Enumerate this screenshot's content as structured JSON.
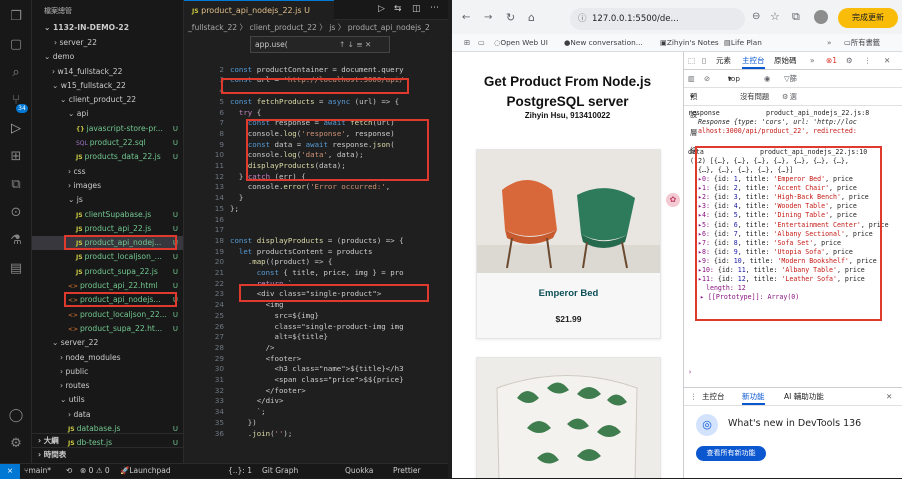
{
  "explorer": {
    "header": "檔案總管",
    "root": "1132-IN-DEMO-22",
    "items": [
      {
        "label": "server_22",
        "kind": "folder",
        "open": false,
        "git": ""
      },
      {
        "label": "demo",
        "kind": "folder",
        "open": true,
        "git": ""
      },
      {
        "label": "w14_fullstack_22",
        "kind": "folder",
        "open": false,
        "git": ""
      },
      {
        "label": "w15_fullstack_22",
        "kind": "folder",
        "open": true,
        "git": ""
      },
      {
        "label": "client_product_22",
        "kind": "folder",
        "open": true,
        "git": ""
      },
      {
        "label": "api",
        "kind": "folder",
        "open": true,
        "git": ""
      },
      {
        "label": "javascript-store-pr...",
        "kind": "file",
        "ext": "{}",
        "git": "U"
      },
      {
        "label": "product_22.sql",
        "kind": "file",
        "ext": "SQL",
        "git": "U"
      },
      {
        "label": "products_data_22.js",
        "kind": "file",
        "ext": "JS",
        "git": "U"
      },
      {
        "label": "css",
        "kind": "folder",
        "open": false,
        "git": ""
      },
      {
        "label": "images",
        "kind": "folder",
        "open": false,
        "git": ""
      },
      {
        "label": "js",
        "kind": "folder",
        "open": true,
        "git": ""
      },
      {
        "label": "clientSupabase.js",
        "kind": "file",
        "ext": "JS",
        "git": "U"
      },
      {
        "label": "product_api_22.js",
        "kind": "file",
        "ext": "JS",
        "git": "U"
      },
      {
        "label": "product_api_nodej...",
        "kind": "file",
        "ext": "JS",
        "git": "U"
      },
      {
        "label": "product_localjson_...",
        "kind": "file",
        "ext": "JS",
        "git": "U"
      },
      {
        "label": "product_supa_22.js",
        "kind": "file",
        "ext": "JS",
        "git": "U"
      },
      {
        "label": "product_api_22.html",
        "kind": "file",
        "ext": "<>",
        "git": "U"
      },
      {
        "label": "product_api_nodejs...",
        "kind": "file",
        "ext": "<>",
        "git": "U"
      },
      {
        "label": "product_localjson_22...",
        "kind": "file",
        "ext": "<>",
        "git": "U"
      },
      {
        "label": "product_supa_22.ht...",
        "kind": "file",
        "ext": "<>",
        "git": "U"
      },
      {
        "label": "server_22",
        "kind": "folder",
        "open": true,
        "git": ""
      },
      {
        "label": "node_modules",
        "kind": "folder",
        "open": false,
        "git": ""
      },
      {
        "label": "public",
        "kind": "folder",
        "open": false,
        "git": ""
      },
      {
        "label": "routes",
        "kind": "folder",
        "open": false,
        "git": ""
      },
      {
        "label": "utils",
        "kind": "folder",
        "open": true,
        "git": ""
      },
      {
        "label": "data",
        "kind": "folder",
        "open": false,
        "git": ""
      },
      {
        "label": "database.js",
        "kind": "file",
        "ext": "JS",
        "git": "U"
      },
      {
        "label": "db-test.js",
        "kind": "file",
        "ext": "JS",
        "git": "U"
      }
    ],
    "outline": "大綱",
    "timeline": "時間表"
  },
  "editor": {
    "tab_label": "product_api_nodejs_22.js",
    "tab_git": "U",
    "breadcrumb": "_fullstack_22 〉 client_product_22 〉 js 〉 product_api_nodejs_2",
    "find_text": "app.use(",
    "lines": [
      {
        "n": "",
        "t": ""
      },
      {
        "n": "2",
        "t": "const productContainer = document.query"
      },
      {
        "n": "3",
        "t": "const url = 'http://localhost:3000/api/"
      },
      {
        "n": "4",
        "t": ""
      },
      {
        "n": "5",
        "t": "const fetchProducts = async (url) => {"
      },
      {
        "n": "6",
        "t": "  try {"
      },
      {
        "n": "7",
        "t": "    const response = await fetch(url)"
      },
      {
        "n": "8",
        "t": "    console.log('response', response)"
      },
      {
        "n": "9",
        "t": "    const data = await response.json("
      },
      {
        "n": "10",
        "t": "    console.log('data', data);"
      },
      {
        "n": "11",
        "t": "    displayProducts(data);"
      },
      {
        "n": "12",
        "t": "  } catch (err) {"
      },
      {
        "n": "13",
        "t": "    console.error('Error occurred:', "
      },
      {
        "n": "14",
        "t": "  }"
      },
      {
        "n": "15",
        "t": "};"
      },
      {
        "n": "16",
        "t": ""
      },
      {
        "n": "17",
        "t": ""
      },
      {
        "n": "18",
        "t": "const displayProducts = (products) => {"
      },
      {
        "n": "19",
        "t": "  let productsContent = products"
      },
      {
        "n": "20",
        "t": "    .map((product) => {"
      },
      {
        "n": "21",
        "t": "      const { title, price, img } = pro"
      },
      {
        "n": "22",
        "t": "      return `"
      },
      {
        "n": "23",
        "t": "      <div class=\"single-product\">"
      },
      {
        "n": "24",
        "t": "        <img"
      },
      {
        "n": "25",
        "t": "          src=${img}"
      },
      {
        "n": "26",
        "t": "          class=\"single-product-img img"
      },
      {
        "n": "27",
        "t": "          alt=${title}"
      },
      {
        "n": "28",
        "t": "        />"
      },
      {
        "n": "29",
        "t": "        <footer>"
      },
      {
        "n": "30",
        "t": "          <h3 class=\"name\">${title}</h3"
      },
      {
        "n": "31",
        "t": "          <span class=\"price\">$${price}"
      },
      {
        "n": "32",
        "t": "        </footer>"
      },
      {
        "n": "33",
        "t": "      </div>"
      },
      {
        "n": "34",
        "t": "      `;"
      },
      {
        "n": "35",
        "t": "    })"
      },
      {
        "n": "36",
        "t": "    .join('');"
      }
    ]
  },
  "statusbar": {
    "branch": "main*",
    "sync": "⟲",
    "errors": "⊗ 0 ⚠ 0",
    "ports": "⑂ 0",
    "launchpad": "Launchpad",
    "position": "{..}: 1",
    "gitgraph": "Git Graph",
    "quokka": "Quokka",
    "prettier": "Prettier"
  },
  "browser": {
    "url": "127.0.0.1:5500/de...",
    "update_button": "完成更新",
    "bookmarks": [
      "Open Web UI",
      "New conversation...",
      "Zihyin's Notes",
      "Life Plan"
    ],
    "all_bookmarks": "所有書籤",
    "page_title": "Get Product From Node.js PostgreSQL server",
    "author": "Zihyin Hsu, 913410022",
    "products": [
      {
        "name": "Emperor Bed",
        "price": "$21.99"
      }
    ]
  },
  "devtools": {
    "tabs": [
      "元素",
      "主控台",
      "原始碼"
    ],
    "active_tab": "主控台",
    "context": "top",
    "filter_placeholder": "篩選",
    "levels": "預設層級",
    "issues": "沒有問題",
    "log_response_label": "response",
    "log_response_link": "product_api_nodejs_22.js:8",
    "log_response_line1": "Response {type: 'cors', url: 'http://loc",
    "log_response_line2": "alhost:3000/api/product_22', redirected:",
    "log_data_label": "data",
    "log_data_link": "product_api_nodejs_22.js:10",
    "log_data_summary": "(12) [{…}, {…}, {…}, {…}, {…}, {…}, {…},",
    "log_data_summary2": "{…}, {…}, {…}, {…}, {…}]",
    "entries": [
      {
        "idx": "0",
        "id": "1",
        "title": "Emperor Bed"
      },
      {
        "idx": "1",
        "id": "2",
        "title": "Accent Chair"
      },
      {
        "idx": "2",
        "id": "3",
        "title": "High-Back Bench"
      },
      {
        "idx": "3",
        "id": "4",
        "title": "Wooden Table"
      },
      {
        "idx": "4",
        "id": "5",
        "title": "Dining Table"
      },
      {
        "idx": "5",
        "id": "6",
        "title": "Entertainment Center"
      },
      {
        "idx": "6",
        "id": "7",
        "title": "Albany Sectional"
      },
      {
        "idx": "7",
        "id": "8",
        "title": "Sofa Set"
      },
      {
        "idx": "8",
        "id": "9",
        "title": "Utopia Sofa"
      },
      {
        "idx": "9",
        "id": "10",
        "title": "Modern Bookshelf"
      },
      {
        "idx": "10",
        "id": "11",
        "title": "Albany Table"
      },
      {
        "idx": "11",
        "id": "12",
        "title": "Leather Sofa"
      }
    ],
    "length_line": "length: 12",
    "prototype_line": "▸ [[Prototype]]: Array(0)",
    "drawer_tabs": [
      "主控台",
      "新功能",
      "AI 輔助功能"
    ],
    "drawer_active": "新功能",
    "whats_new": "What's new in DevTools 136",
    "whats_new_btn": "查看所有新功能"
  },
  "colors": {
    "highlight_box": "#e03a2e",
    "vscode_bg": "#1e1e1e",
    "accent": "#0078d4",
    "update_btn": "#f9bc09"
  }
}
